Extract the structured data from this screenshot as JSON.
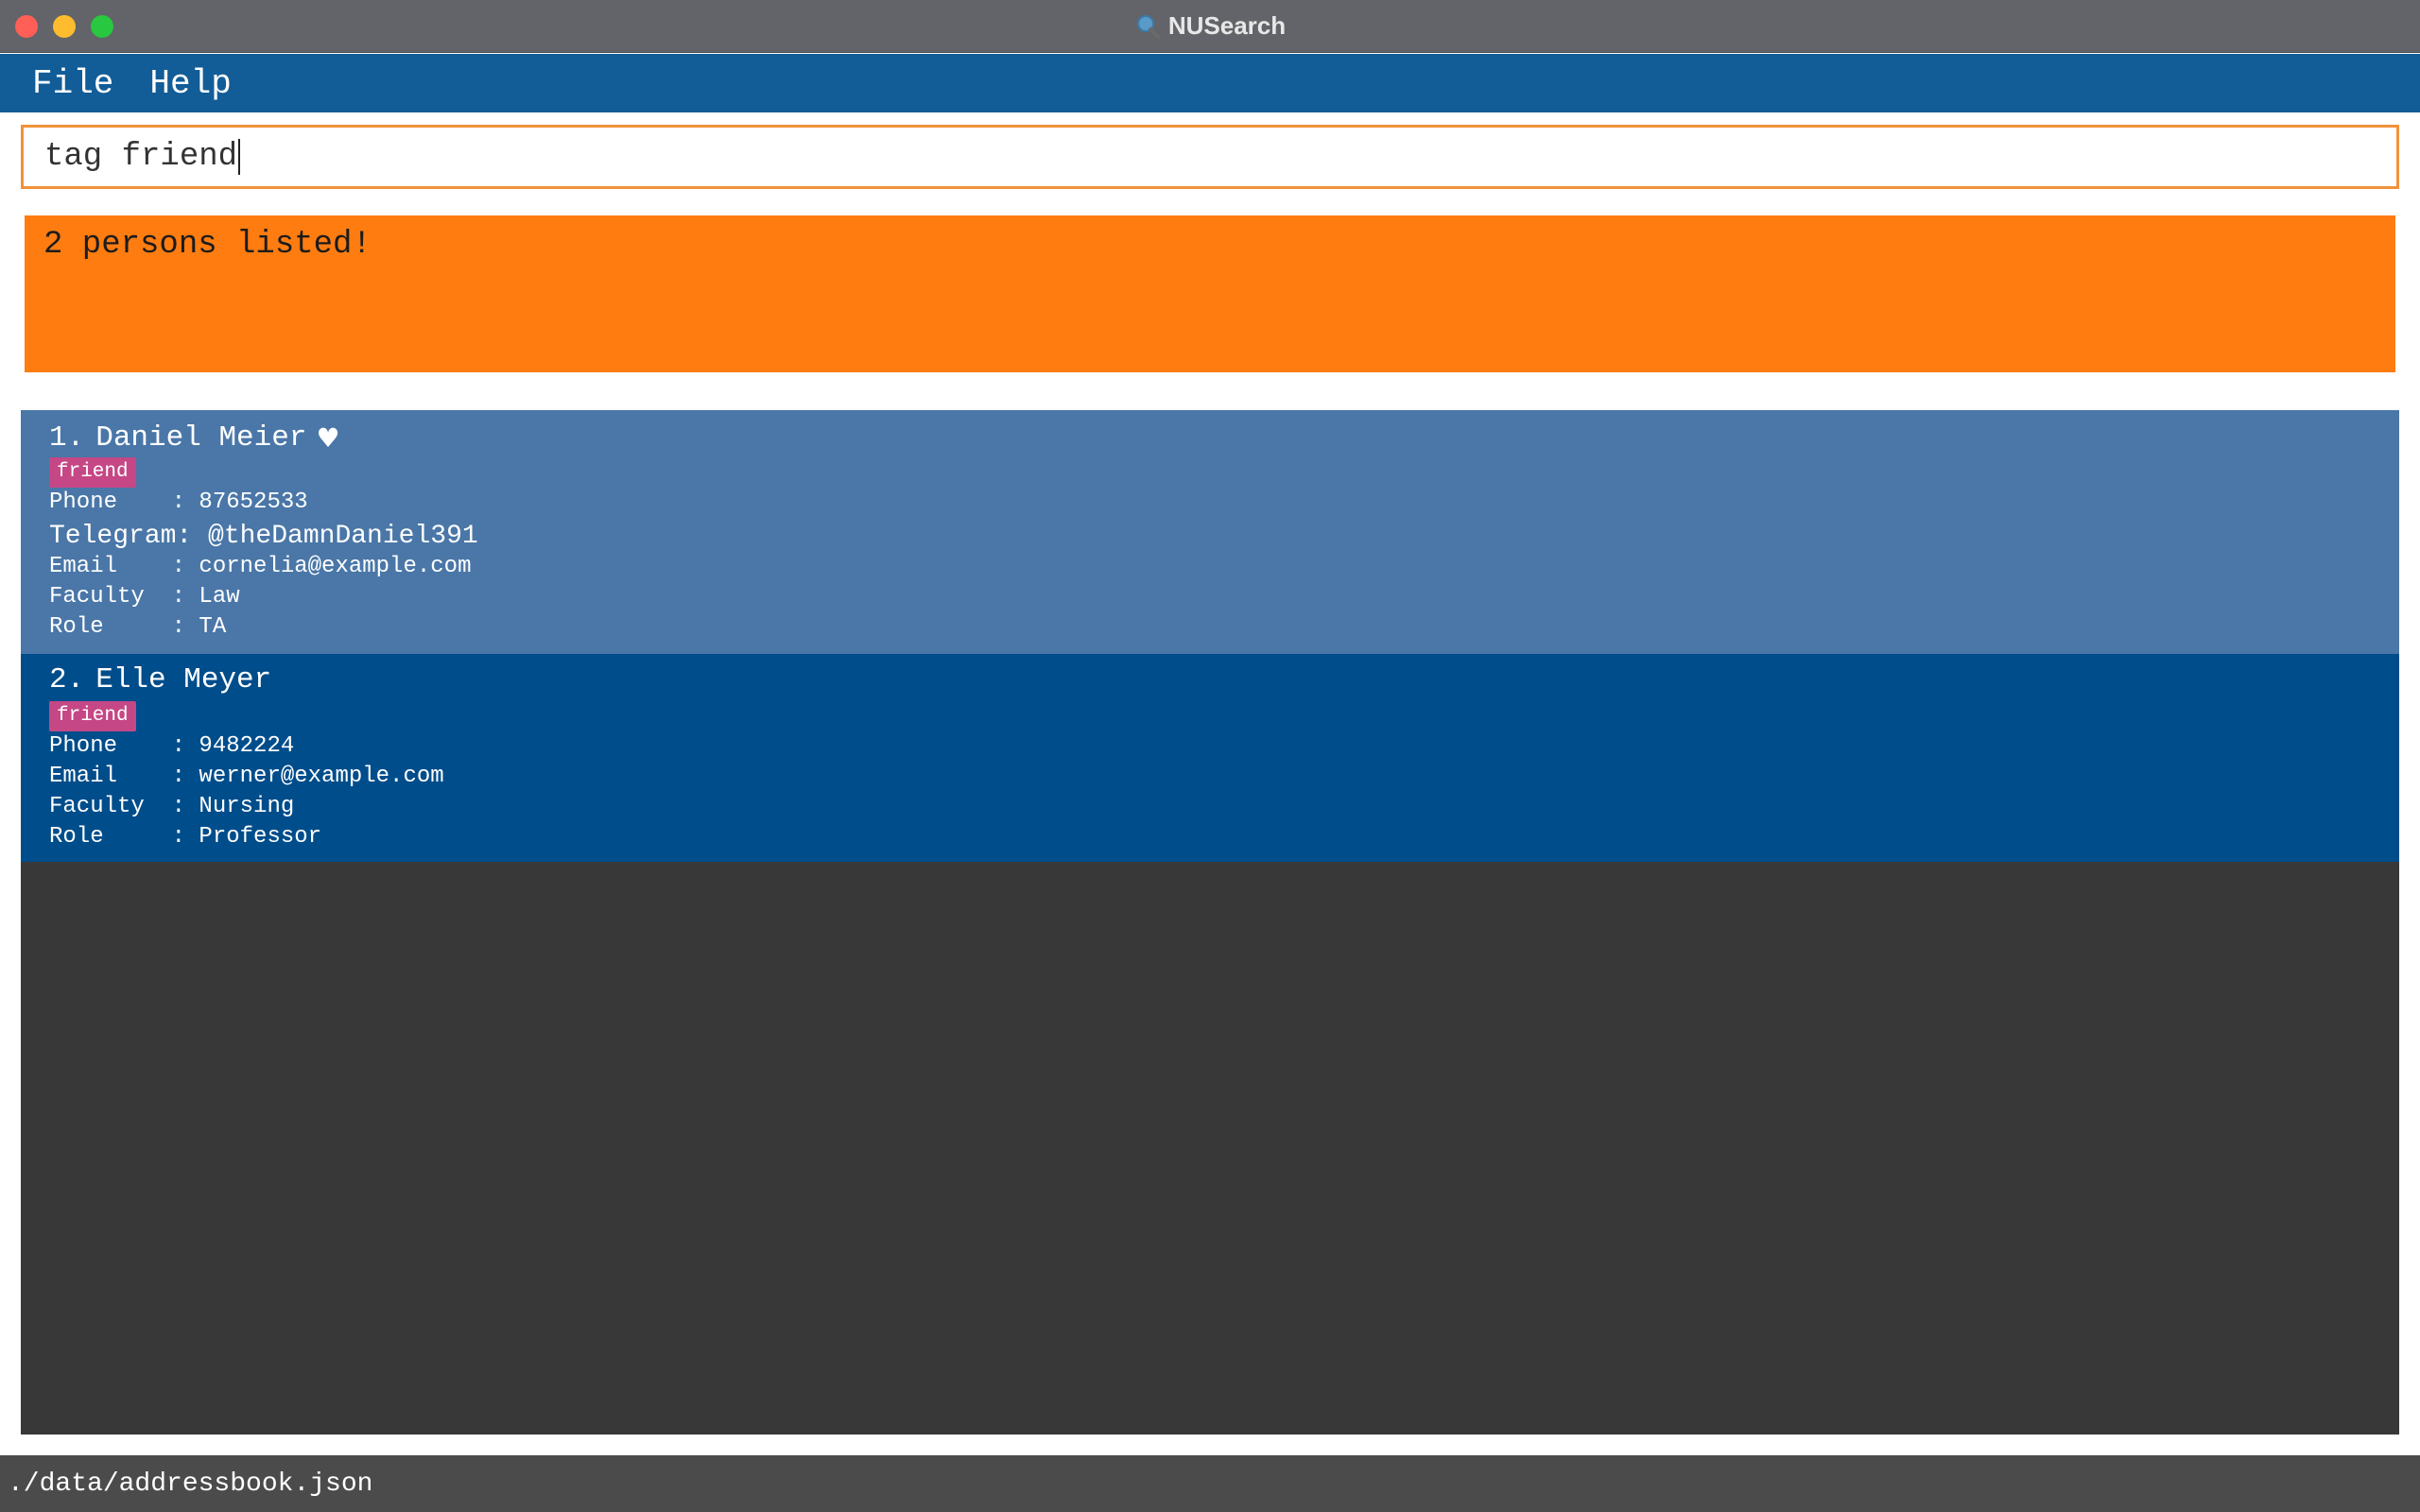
{
  "window": {
    "title": "NUSearch",
    "title_icon": "search-icon",
    "controls": {
      "close_color": "#ff5f57",
      "minimize_color": "#febc2e",
      "maximize_color": "#28c840"
    }
  },
  "menu": {
    "items": [
      {
        "label": "File"
      },
      {
        "label": "Help"
      }
    ]
  },
  "command": {
    "value": "tag friend",
    "border_color": "#f0923a"
  },
  "result": {
    "message": "2 persons listed!",
    "background": "#ff7c10"
  },
  "persons": [
    {
      "index": "1.",
      "name": "Daniel Meier",
      "favourite_icon": "heart-icon",
      "favourite_symbol": "♥",
      "tag": "friend",
      "fields": {
        "phone": "Phone    : 87652533",
        "telegram": "Telegram: @theDamnDaniel391",
        "email": "Email    : cornelia@example.com",
        "faculty": "Faculty  : Law",
        "role": "Role     : TA"
      },
      "background": "#4a77a8"
    },
    {
      "index": "2.",
      "name": "Elle Meyer",
      "tag": "friend",
      "fields": {
        "phone": "Phone    : 9482224",
        "email": "Email    : werner@example.com",
        "faculty": "Faculty  : Nursing",
        "role": "Role     : Professor"
      },
      "background": "#004d8b"
    }
  ],
  "tag_color": "#c54785",
  "status": {
    "file_path": "./data/addressbook.json"
  }
}
